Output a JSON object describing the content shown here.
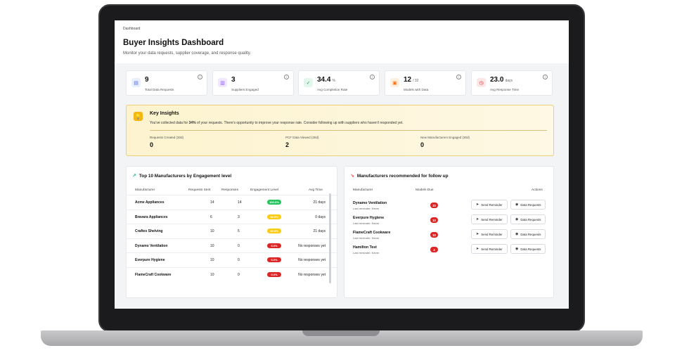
{
  "breadcrumb": "Dashboard",
  "title": "Buyer Insights Dashboard",
  "subtitle": "Monitor your data requests, supplier coverage, and response quality.",
  "stats": [
    {
      "value": "9",
      "unit": "",
      "label": "Total Data Requests",
      "icon": "document-icon",
      "glyph": "▤",
      "bg": "#e8efff",
      "fg": "#4f6bed"
    },
    {
      "value": "3",
      "unit": "",
      "label": "Suppliers Engaged",
      "icon": "building-icon",
      "glyph": "▥",
      "bg": "#f1e7ff",
      "fg": "#8b5cf6"
    },
    {
      "value": "34.4",
      "unit": "%",
      "label": "Avg Completion Rate",
      "icon": "check-circle-icon",
      "glyph": "✓",
      "bg": "#e4f7ec",
      "fg": "#16a34a"
    },
    {
      "value": "12",
      "unit": "/ 32",
      "label": "Models with Data",
      "icon": "cube-icon",
      "glyph": "▣",
      "bg": "#fff0e0",
      "fg": "#f97316"
    },
    {
      "value": "23.0",
      "unit": "days",
      "label": "Avg Response Time",
      "icon": "clock-icon",
      "glyph": "◷",
      "bg": "#fde8e8",
      "fg": "#dc2626"
    }
  ],
  "insights": {
    "title": "Key Insights",
    "text_before": "You've collected data for ",
    "text_bold": "34%",
    "text_after": " of your requests. There's opportunity to improve your response rate. Consider following up with suppliers who haven't responded yet.",
    "metrics": [
      {
        "label": "Requests Created (30d)",
        "value": "0"
      },
      {
        "label": "PCF Data Viewed (30d)",
        "value": "2"
      },
      {
        "label": "New Manufacturers Engaged (30d)",
        "value": "0"
      }
    ]
  },
  "top10": {
    "title": "Top 10 Manufacturers by Engagement level",
    "headers": [
      "Manufacturer",
      "Requests Sent",
      "Responses",
      "Engagement Level",
      "Avg Time"
    ],
    "rows": [
      {
        "name": "Acme Appliances",
        "sent": "14",
        "responses": "14",
        "level": "100.0%",
        "color": "#22c55e",
        "time": "21 days"
      },
      {
        "name": "Bravara Appliances",
        "sent": "6",
        "responses": "3",
        "level": "50.0%",
        "color": "#facc15",
        "time": "0 days"
      },
      {
        "name": "Craftex Shelving",
        "sent": "10",
        "responses": "5",
        "level": "50.0%",
        "color": "#facc15",
        "time": "21 days"
      },
      {
        "name": "Dynamo Ventilation",
        "sent": "10",
        "responses": "0",
        "level": "0.0%",
        "color": "#dc2626",
        "time": "No responses yet"
      },
      {
        "name": "Everpure Hygiene",
        "sent": "10",
        "responses": "0",
        "level": "0.0%",
        "color": "#dc2626",
        "time": "No responses yet"
      },
      {
        "name": "FlameCraft Cookware",
        "sent": "10",
        "responses": "0",
        "level": "0.0%",
        "color": "#dc2626",
        "time": "No responses yet"
      }
    ]
  },
  "followup": {
    "title": "Manufacturers recommended for follow up",
    "headers": [
      "Manufacturer",
      "Models Due",
      "Actions"
    ],
    "send_label": "Send Reminder",
    "data_label": "Data Requests",
    "rows": [
      {
        "name": "Dynamo Ventilation",
        "sub": "Last reminder: Never",
        "due": "10"
      },
      {
        "name": "Everpure Hygiene",
        "sub": "Last reminder: Never",
        "due": "10"
      },
      {
        "name": "FlameCraft Cookware",
        "sub": "Last reminder: Never",
        "due": "10"
      },
      {
        "name": "Hamilton Test",
        "sub": "Last reminder: Never",
        "due": "4"
      }
    ]
  }
}
